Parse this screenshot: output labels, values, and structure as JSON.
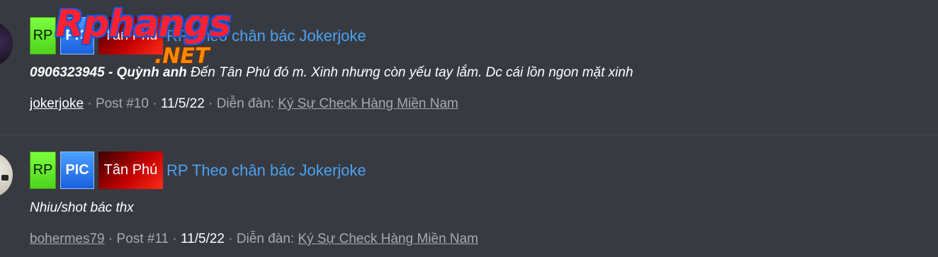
{
  "watermark": {
    "brand": "Rphangs",
    "suffix": ".NET"
  },
  "posts": [
    {
      "tags": {
        "rp": "RP",
        "pic": "PIC",
        "location": "Tân Phú"
      },
      "title": "RP Theo chân bác Jokerjoke",
      "snippet_bold": "0906323945 - Quỳnh anh",
      "snippet_rest": " Đến Tân Phú đó m. Xinh nhưng còn yếu tay lắm. Dc cái lồn ngon mặt xinh",
      "author": "jokerjoke",
      "post_no": "Post #10",
      "date": "11/5/22",
      "forum_label": "Diễn đàn:",
      "forum": "Ký Sự Check Hàng Miền Nam",
      "separator": " · "
    },
    {
      "tags": {
        "rp": "RP",
        "pic": "PIC",
        "location": "Tân Phú"
      },
      "title": "RP Theo chân bác Jokerjoke",
      "snippet_bold": "",
      "snippet_rest": "Nhiu/shot bác thx",
      "author": "bohermes79",
      "post_no": "Post #11",
      "date": "11/5/22",
      "forum_label": "Diễn đàn:",
      "forum": "Ký Sự Check Hàng Miền Nam",
      "separator": " · "
    }
  ]
}
